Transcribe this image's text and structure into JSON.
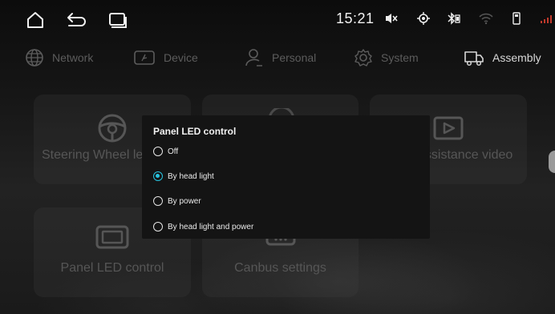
{
  "status_bar": {
    "time": "15:21",
    "icons": [
      "home-icon",
      "back-icon",
      "recent-apps-icon",
      "mute-icon",
      "gps-icon",
      "bluetooth-icon",
      "wifi-icon",
      "usb-icon",
      "signal-icon"
    ]
  },
  "tabs": [
    {
      "label": "Network",
      "icon": "globe-icon",
      "active": false
    },
    {
      "label": "Device",
      "icon": "device-icon",
      "active": false
    },
    {
      "label": "Personal",
      "icon": "person-icon",
      "active": false
    },
    {
      "label": "System",
      "icon": "gear-icon",
      "active": false
    },
    {
      "label": "Assembly",
      "icon": "car-icon",
      "active": true
    }
  ],
  "tiles": [
    {
      "label": "Steering Wheel le",
      "icon": "steering-wheel-icon"
    },
    {
      "label": "",
      "icon": "camera-icon"
    },
    {
      "label": "assistance video",
      "icon": "video-icon"
    },
    {
      "label": "Panel LED control",
      "icon": "panel-led-icon"
    },
    {
      "label": "Canbus settings",
      "icon": "canbus-icon"
    }
  ],
  "dialog": {
    "title": "Panel LED control",
    "options": [
      {
        "label": "Off",
        "checked": false
      },
      {
        "label": "By head light",
        "checked": true
      },
      {
        "label": "By power",
        "checked": false
      },
      {
        "label": "By head light and power",
        "checked": false
      }
    ]
  },
  "colors": {
    "accent": "#27c4e0",
    "dialog_bg": "#141414",
    "active_tab": "#d8d8d8",
    "inactive_tab": "#5c5c5c"
  }
}
